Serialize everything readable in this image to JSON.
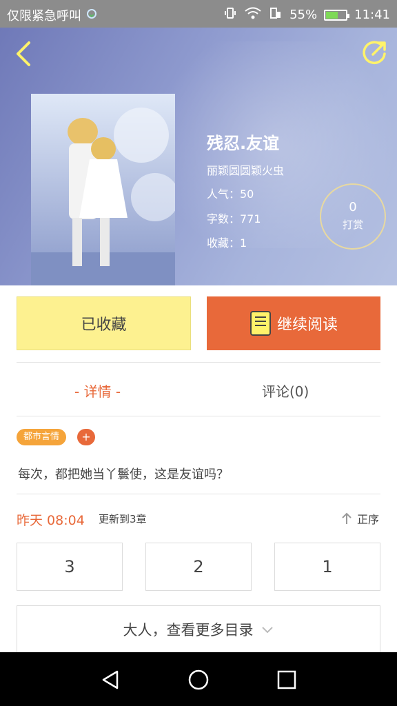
{
  "status_bar": {
    "carrier_text": "仅限紧急呼叫",
    "battery_percent": "55%",
    "time": "11:41"
  },
  "book": {
    "title": "残忍.友谊",
    "author": "丽颖圆圆颖火虫",
    "popularity": "人气：50",
    "word_count": "字数：771",
    "collections": "收藏：1",
    "reward_count": "0",
    "reward_label": "打赏"
  },
  "actions": {
    "collected_label": "已收藏",
    "continue_read_label": "继续阅读"
  },
  "tabs": {
    "detail": "- 详情 -",
    "comments": "评论(0)"
  },
  "tags": {
    "category": "都市言情",
    "add": "+"
  },
  "description": "每次，都把她当丫鬟使，这是友谊吗？",
  "update": {
    "time": "昨天 08:04",
    "info": "更新到3章",
    "sort_label": "正序"
  },
  "chapters": [
    "3",
    "2",
    "1"
  ],
  "more_catalog_label": "大人，查看更多目录",
  "colors": {
    "accent": "#e8693a",
    "collected_bg": "#fdf190",
    "tag_bg": "#f5a43a"
  }
}
